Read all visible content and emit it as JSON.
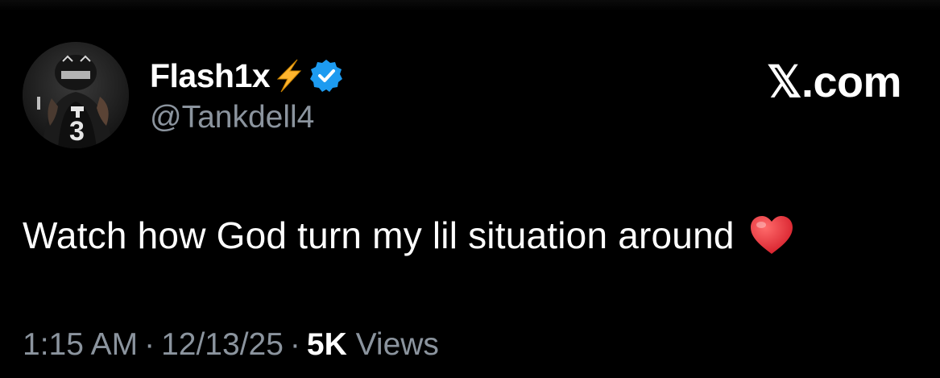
{
  "tweet": {
    "author": {
      "display_name": "Flash1x",
      "handle": "@Tankdell4",
      "avatar_icon": "profile-photo",
      "badges": [
        "lightning-bolt-emoji",
        "verified-checkmark-icon"
      ]
    },
    "brand_watermark": "𝕏.com",
    "text": "Watch how God turn my lil situation around",
    "text_emoji": "red-heart-emoji",
    "time": "1:15 AM",
    "date": "12/13/25",
    "separator": "·",
    "view_count": "5K",
    "views_label": "Views"
  },
  "colors": {
    "background": "#000000",
    "primary_text": "#ffffff",
    "secondary_text": "#8b949e",
    "verified_blue": "#1d9bf0",
    "bolt_yellow": "#ffb52e",
    "heart_red": "#e0245e"
  }
}
